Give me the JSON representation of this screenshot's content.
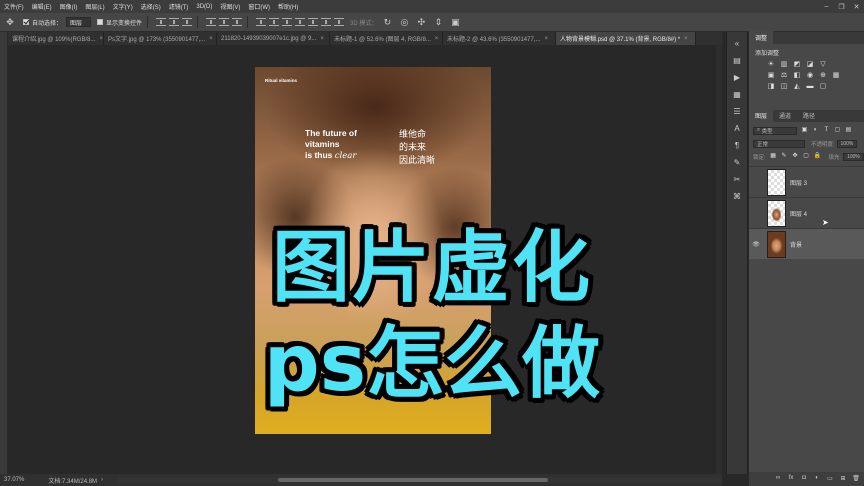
{
  "menu": {
    "items": [
      "文件(F)",
      "编辑(E)",
      "图像(I)",
      "图层(L)",
      "文字(Y)",
      "选择(S)",
      "滤镜(T)",
      "3D(D)",
      "视图(V)",
      "窗口(W)",
      "帮助(H)"
    ]
  },
  "options": {
    "auto_select_label": "自动选择：",
    "auto_select_value": "图层",
    "show_transform_label": "显示变换控件",
    "mode_3d_label": "3D 模式："
  },
  "tabs": [
    {
      "label": "课程介绍.jpg @ 109%(RGB/8...",
      "active": false
    },
    {
      "label": "Ps文字.jpg @ 173% (3550901477,...",
      "active": false
    },
    {
      "label": "211820-14939039007e1c.jpg @ 9...",
      "active": false
    },
    {
      "label": "未标题-1 @ 52.6% (图层 4, RGB/8...",
      "active": false
    },
    {
      "label": "未标题-2 @ 43.6% (3550901477,...",
      "active": false
    },
    {
      "label": "人物背景模糊.psd @ 37.1% (背景, RGB/8#) *",
      "active": true
    }
  ],
  "document": {
    "brand": "Ritual vitamins",
    "en_line1": "The future of",
    "en_line2": "vitamins",
    "en_line3": "is thus",
    "en_clear": "clear",
    "zh_line1": "维他命",
    "zh_line2": "的未来",
    "zh_line3": "因此清晰"
  },
  "overlay": {
    "line1": "图片虚化",
    "line2": "ps怎么做",
    "color": "#4fe3f5"
  },
  "status": {
    "zoom": "37.07%",
    "doc_info": "文档:7.34M/24.8M"
  },
  "adjustments": {
    "tab": "调整",
    "title": "添加调整"
  },
  "layers_panel": {
    "tabs": [
      "图层",
      "通道",
      "路径"
    ],
    "kind_filter": "类型",
    "blend_mode": "正常",
    "opacity_label": "不透明度:",
    "opacity_value": "100%",
    "lock_label": "锁定:",
    "fill_label": "填充:",
    "fill_value": "100%",
    "layers": [
      {
        "name": "图层 3",
        "visible": false,
        "selected": false
      },
      {
        "name": "图层 4",
        "visible": false,
        "selected": false
      },
      {
        "name": "背景",
        "visible": true,
        "selected": true
      }
    ]
  },
  "icons": {
    "eye": "eye-icon",
    "move": "move-tool-icon",
    "close": "close-icon"
  }
}
